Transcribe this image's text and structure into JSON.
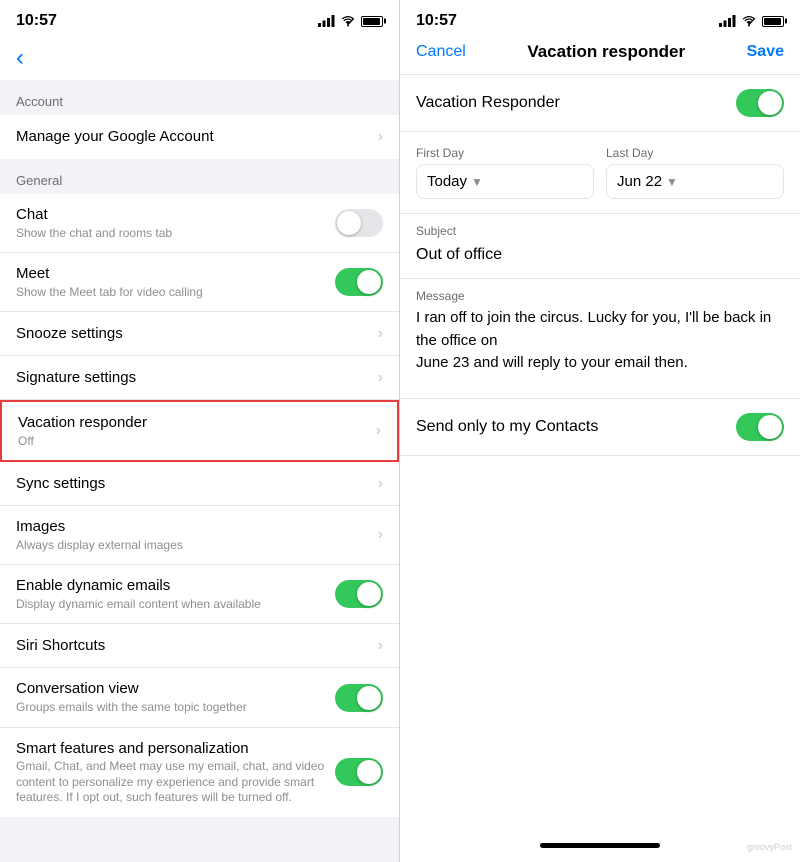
{
  "left": {
    "statusBar": {
      "time": "10:57"
    },
    "sections": [
      {
        "header": "Account",
        "items": [
          {
            "title": "Manage your Google Account",
            "subtitle": "",
            "control": "chevron"
          }
        ]
      },
      {
        "header": "General",
        "items": [
          {
            "title": "Chat",
            "subtitle": "Show the chat and rooms tab",
            "control": "toggle-off"
          },
          {
            "title": "Meet",
            "subtitle": "Show the Meet tab for video calling",
            "control": "toggle-on"
          },
          {
            "title": "Snooze settings",
            "subtitle": "",
            "control": "chevron"
          },
          {
            "title": "Signature settings",
            "subtitle": "",
            "control": "chevron"
          },
          {
            "title": "Vacation responder",
            "subtitle": "Off",
            "control": "chevron",
            "highlighted": true
          },
          {
            "title": "Sync settings",
            "subtitle": "",
            "control": "chevron"
          },
          {
            "title": "Images",
            "subtitle": "Always display external images",
            "control": "chevron"
          },
          {
            "title": "Enable dynamic emails",
            "subtitle": "Display dynamic email content when available",
            "control": "toggle-on"
          },
          {
            "title": "Siri Shortcuts",
            "subtitle": "",
            "control": "chevron"
          },
          {
            "title": "Conversation view",
            "subtitle": "Groups emails with the same topic together",
            "control": "toggle-on"
          },
          {
            "title": "Smart features and personalization",
            "subtitle": "Gmail, Chat, and Meet may use my email, chat, and video content to personalize my experience and provide smart features. If I opt out, such features will be turned off.",
            "control": "toggle-on"
          }
        ]
      }
    ]
  },
  "right": {
    "statusBar": {
      "time": "10:57"
    },
    "navBar": {
      "cancel": "Cancel",
      "title": "Vacation responder",
      "save": "Save"
    },
    "vacationToggle": {
      "label": "Vacation Responder",
      "on": true
    },
    "firstDay": {
      "label": "First Day",
      "value": "Today"
    },
    "lastDay": {
      "label": "Last Day",
      "value": "Jun 22"
    },
    "subject": {
      "label": "Subject",
      "value": "Out of office"
    },
    "message": {
      "label": "Message",
      "value": "I ran off to join the circus. Lucky for you, I'll be back in the office on\nJune 23 and will reply to your email then."
    },
    "contactsOnly": {
      "label": "Send only to my Contacts",
      "on": true
    },
    "watermark": "groovyPost"
  }
}
